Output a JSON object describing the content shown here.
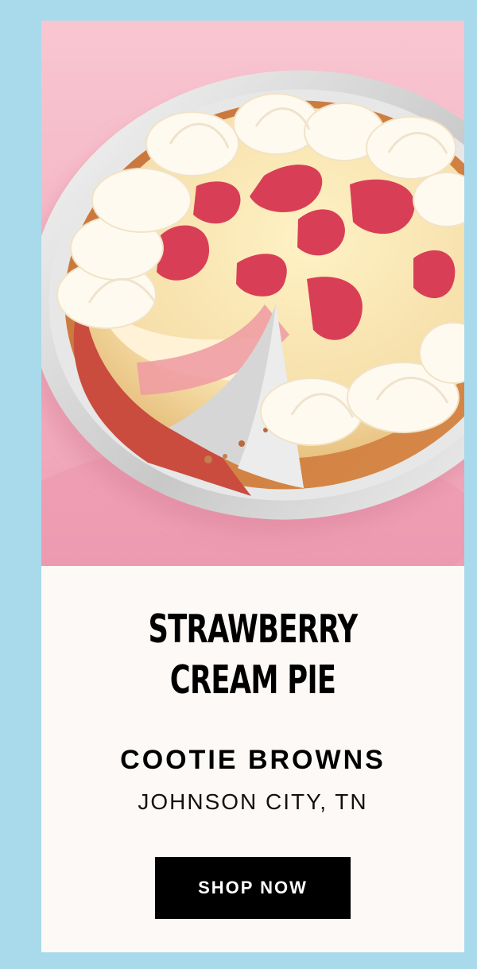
{
  "product": {
    "image_name": "strawberry-cream-pie-photo",
    "title_line_1": "STRAWBERRY",
    "title_line_2": "CREAM PIE",
    "brand": "COOTIE BROWNS",
    "location": "JOHNSON CITY, TN",
    "button_label": "SHOP NOW"
  },
  "colors": {
    "page_background": "#a8daec",
    "card_background": "#fdf9f6",
    "photo_background": "#f3b1c2",
    "button_background": "#000000",
    "button_text": "#ffffff"
  }
}
